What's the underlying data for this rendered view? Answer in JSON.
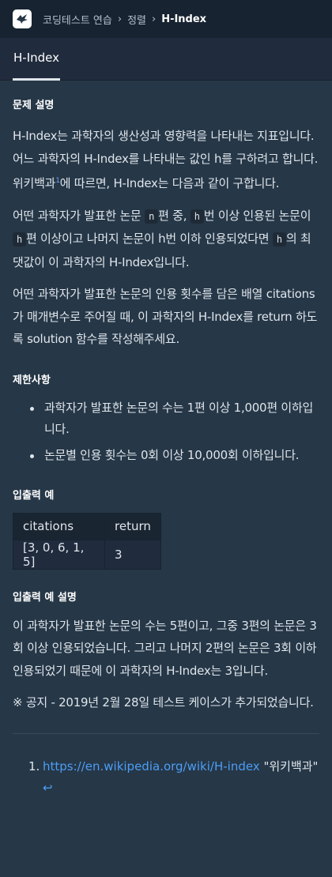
{
  "breadcrumb": {
    "items": [
      "코딩테스트 연습",
      "정렬"
    ],
    "current": "H-Index"
  },
  "tab": {
    "label": "H-Index"
  },
  "description": {
    "title": "문제 설명",
    "p1_a": "H-Index는 과학자의 생산성과 영향력을 나타내는 지표입니다. 어느 과학자의 H-Index를 나타내는 값인 h를 구하려고 합니다. 위키백과",
    "p1_sup": "1",
    "p1_b": "에 따르면, H-Index는 다음과 같이 구합니다.",
    "p2_a": "어떤 과학자가 발표한 논문 ",
    "p2_code1": "n",
    "p2_b": "편 중, ",
    "p2_code2": "h",
    "p2_c": "번 이상 인용된 논문이 ",
    "p2_code3": "h",
    "p2_d": "편 이상이고 나머지 논문이 h번 이하 인용되었다면 ",
    "p2_code4": "h",
    "p2_e": "의 최댓값이 이 과학자의 H-Index입니다.",
    "p3": "어떤 과학자가 발표한 논문의 인용 횟수를 담은 배열 citations가 매개변수로 주어질 때, 이 과학자의 H-Index를 return 하도록 solution 함수를 작성해주세요."
  },
  "limits": {
    "title": "제한사항",
    "items": [
      "과학자가 발표한 논문의 수는 1편 이상 1,000편 이하입니다.",
      "논문별 인용 횟수는 0회 이상 10,000회 이하입니다."
    ]
  },
  "io_example": {
    "title": "입출력 예",
    "headers": [
      "citations",
      "return"
    ],
    "rows": [
      [
        "[3, 0, 6, 1, 5]",
        "3"
      ]
    ]
  },
  "io_explanation": {
    "title": "입출력 예 설명",
    "p1": "이 과학자가 발표한 논문의 수는 5편이고, 그중 3편의 논문은 3회 이상 인용되었습니다. 그리고 나머지 2편의 논문은 3회 이하 인용되었기 때문에 이 과학자의 H-Index는 3입니다.",
    "notice": "※ 공지 - 2019년 2월 28일 테스트 케이스가 추가되었습니다."
  },
  "footnotes": {
    "items": [
      {
        "number": "1.",
        "link": "https://en.wikipedia.org/wiki/H-index",
        "text": " \"위키백과\" ",
        "back": "↩"
      }
    ]
  },
  "colors": {
    "background": "#263747",
    "topbar": "#172330",
    "link": "#4c9ef6"
  }
}
